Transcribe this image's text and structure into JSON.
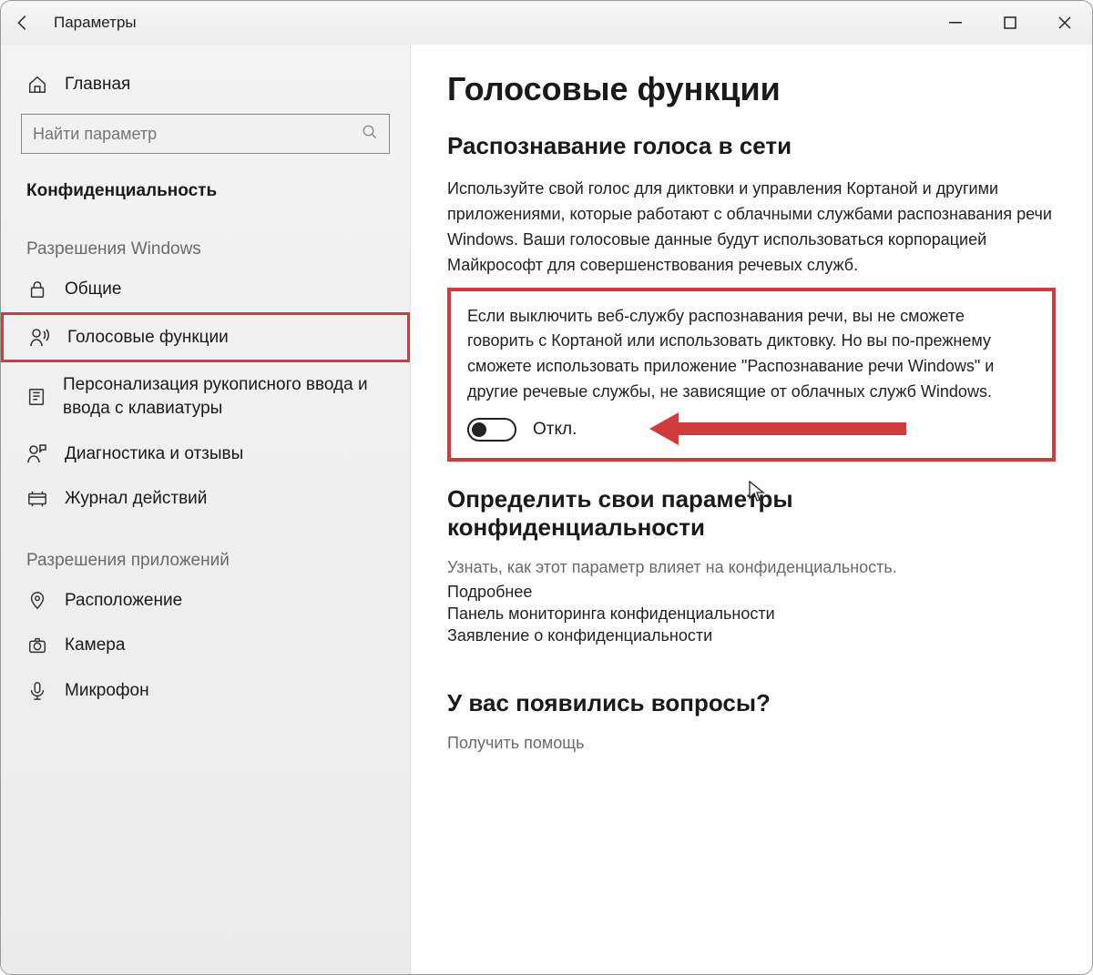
{
  "titlebar": {
    "title": "Параметры"
  },
  "sidebar": {
    "home_label": "Главная",
    "search_placeholder": "Найти параметр",
    "group_label": "Конфиденциальность",
    "section_win": "Разрешения Windows",
    "items_win": [
      {
        "icon": "lock",
        "label": "Общие"
      },
      {
        "icon": "voice",
        "label": "Голосовые функции"
      },
      {
        "icon": "ink",
        "label": "Персонализация рукописного ввода и ввода с клавиатуры"
      },
      {
        "icon": "feedback",
        "label": "Диагностика и отзывы"
      },
      {
        "icon": "history",
        "label": "Журнал действий"
      }
    ],
    "section_app": "Разрешения приложений",
    "items_app": [
      {
        "icon": "location",
        "label": "Расположение"
      },
      {
        "icon": "camera",
        "label": "Камера"
      },
      {
        "icon": "mic",
        "label": "Микрофон"
      }
    ]
  },
  "main": {
    "h1": "Голосовые функции",
    "h2_online": "Распознавание голоса в сети",
    "p_online": "Используйте свой голос для диктовки и управления Кортаной и другими приложениями, которые работают с облачными службами распознавания речи Windows. Ваши голосовые данные будут использоваться корпорацией Майкрософт для совершенствования речевых служб.",
    "box_p": "Если выключить веб-службу распознавания речи, вы не сможете говорить с Кортаной или использовать диктовку. Но вы по-прежнему сможете использовать приложение \"Распознавание речи Windows\" и другие речевые службы, не зависящие от облачных служб Windows.",
    "toggle_label": "Откл.",
    "h2_priv": "Определить свои параметры конфиденциальности",
    "priv_sub": "Узнать, как этот параметр влияет на конфиденциальность.",
    "link_more": "Подробнее",
    "link_dashboard": "Панель мониторинга конфиденциальности",
    "link_statement": "Заявление о конфиденциальности",
    "h2_q": "У вас появились вопросы?",
    "help_link": "Получить помощь"
  }
}
